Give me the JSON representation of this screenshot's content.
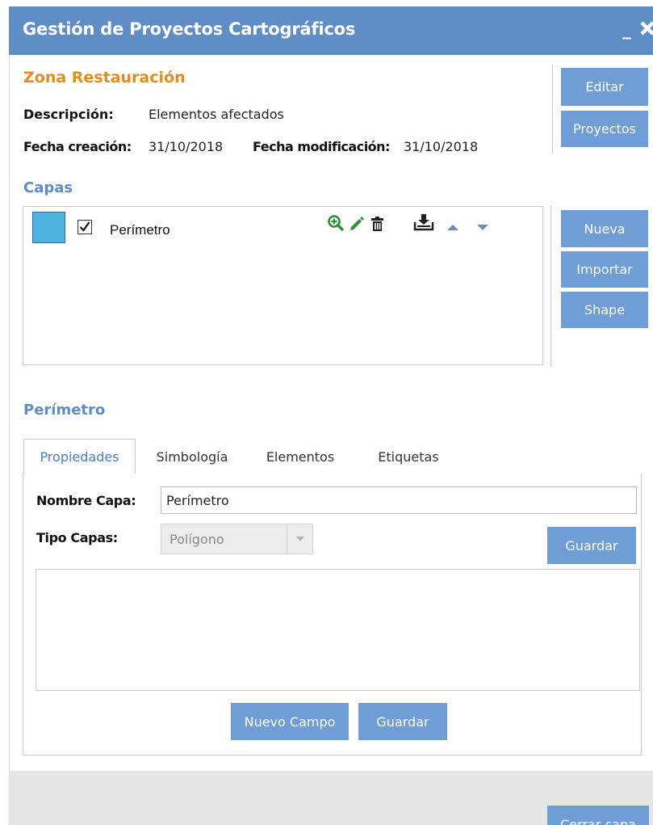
{
  "window": {
    "title": "Gestión de Proyectos Cartográficos",
    "minimize_glyph": "_",
    "close_icon": "close-icon"
  },
  "project": {
    "name": "Zona Restauración",
    "description_label": "Descripción:",
    "description_value": "Elementos afectados",
    "created_label": "Fecha creación:",
    "created_value": "31/10/2018",
    "modified_label": "Fecha modificación:",
    "modified_value": "31/10/2018",
    "buttons": {
      "edit": "Editar",
      "projects": "Proyectos"
    }
  },
  "layers": {
    "title": "Capas",
    "items": [
      {
        "name": "Perímetro",
        "checked": true,
        "color": "#4fb3e0",
        "actions": [
          "zoom-in-icon",
          "pencil-icon",
          "trash-icon",
          "download-icon",
          "arrow-up-icon",
          "arrow-down-icon"
        ]
      }
    ],
    "buttons": {
      "new": "Nueva",
      "import": "Importar",
      "shape": "Shape"
    }
  },
  "layer_detail": {
    "title": "Perímetro",
    "tabs": [
      {
        "label": "Propiedades",
        "active": true
      },
      {
        "label": "Simbología",
        "active": false
      },
      {
        "label": "Elementos",
        "active": false
      },
      {
        "label": "Etiquetas",
        "active": false
      }
    ],
    "properties": {
      "name_label": "Nombre Capa:",
      "name_value": "Perímetro",
      "type_label": "Tipo Capas:",
      "type_value": "Polígono",
      "save_label": "Guardar",
      "new_field_label": "Nuevo Campo",
      "save_fields_label": "Guardar"
    }
  },
  "footer": {
    "close_layer_label": "Cerrar capa"
  },
  "colors": {
    "titlebar": "#5f8ec7",
    "button": "#6f9ed6",
    "project_name": "#e08e1c",
    "section_title": "#5f8ec7",
    "icon_green": "#2f8f3a"
  }
}
